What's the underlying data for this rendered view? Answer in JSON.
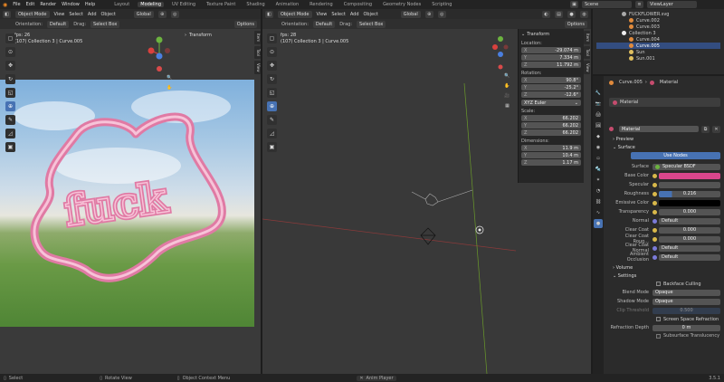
{
  "menu": {
    "items": [
      "File",
      "Edit",
      "Render",
      "Window",
      "Help"
    ]
  },
  "workspaces": [
    "Layout",
    "Modeling",
    "UV Editing",
    "Texture Paint",
    "Shading",
    "Animation",
    "Rendering",
    "Compositing",
    "Geometry Nodes",
    "Scripting"
  ],
  "active_workspace": "Modeling",
  "scene": {
    "name": "Scene",
    "view_layer": "ViewLayer"
  },
  "left_editor": {
    "mode": "Object Mode",
    "view": "View",
    "select": "Select",
    "add": "Add",
    "object": "Object",
    "transform": "Global",
    "orientation_label": "Orientation:",
    "orientation": "Default",
    "drag_label": "Drag:",
    "drag": "Select Box",
    "options": "Options",
    "fps": "fps: 26",
    "collection_info": "(107) Collection 3 | Curve.005",
    "transform_tab": "Transform",
    "overlay_text": "fuck"
  },
  "right_editor": {
    "mode": "Object Mode",
    "view": "View",
    "select": "Select",
    "add": "Add",
    "object": "Object",
    "transform": "Global",
    "orientation_label": "Orientation:",
    "orientation": "Default",
    "drag_label": "Drag:",
    "drag": "Select Box",
    "options": "Options",
    "fps": "fps: 28",
    "collection_info": "(107) Collection 3 | Curve.005"
  },
  "n_panel": {
    "title": "Transform",
    "location_label": "Location:",
    "location": [
      {
        "axis": "X",
        "value": "-29.074 m"
      },
      {
        "axis": "Y",
        "value": "7.334 m"
      },
      {
        "axis": "Z",
        "value": "11.792 m"
      }
    ],
    "rotation_label": "Rotation:",
    "rotation": [
      {
        "axis": "X",
        "value": "90.8°"
      },
      {
        "axis": "Y",
        "value": "-25.2°"
      },
      {
        "axis": "Z",
        "value": "-12.6°"
      }
    ],
    "rotation_mode": "XYZ Euler",
    "scale_label": "Scale:",
    "scale": [
      {
        "axis": "X",
        "value": "66.202"
      },
      {
        "axis": "Y",
        "value": "66.202"
      },
      {
        "axis": "Z",
        "value": "66.202"
      }
    ],
    "dimensions_label": "Dimensions:",
    "dimensions": [
      {
        "axis": "X",
        "value": "11.9 m"
      },
      {
        "axis": "Y",
        "value": "10.4 m"
      },
      {
        "axis": "Z",
        "value": "1.17 m"
      }
    ]
  },
  "side_tabs": [
    "Item",
    "Tool",
    "View"
  ],
  "outliner": {
    "items": [
      "FUCKFLOWER.svg",
      "Curve.002",
      "Curve.003",
      "Collection 3",
      "Curve.004",
      "Curve.005",
      "Sun",
      "Sun.001"
    ]
  },
  "properties": {
    "object": "Curve.005",
    "material_crumb": "Material",
    "slot": "Material",
    "material_name": "Material",
    "sections": {
      "preview": "Preview",
      "surface": "Surface",
      "volume": "Volume",
      "settings": "Settings"
    },
    "use_nodes": "Use Nodes",
    "surface_label": "Surface",
    "surface_value": "Specular BSDF",
    "rows": [
      {
        "label": "Base Color",
        "value": ""
      },
      {
        "label": "Specular",
        "value": ""
      },
      {
        "label": "Roughness",
        "value": "0.216"
      },
      {
        "label": "Emissive Color",
        "value": ""
      },
      {
        "label": "Transparency",
        "value": "0.000"
      },
      {
        "label": "Normal",
        "value": "Default"
      },
      {
        "label": "Clear Coat",
        "value": "0.000"
      },
      {
        "label": "Clear Coat Roug...",
        "value": "0.000"
      },
      {
        "label": "Clear Coat Normal",
        "value": "Default"
      },
      {
        "label": "Ambient Occlusion",
        "value": "Default"
      }
    ],
    "backface_culling": "Backface Culling",
    "blend_mode_label": "Blend Mode",
    "blend_mode": "Opaque",
    "shadow_mode_label": "Shadow Mode",
    "shadow_mode": "Opaque",
    "clip_threshold_label": "Clip Threshold",
    "clip_threshold": "0.500",
    "screen_space_refraction": "Screen Space Refraction",
    "refraction_depth_label": "Refraction Depth",
    "refraction_depth": "0 m",
    "subsurface": "Subsurface Translucency"
  },
  "status": {
    "select": "Select",
    "rotate": "Rotate View",
    "context": "Object Context Menu",
    "anim": "Anim Player",
    "version": "3.5.1"
  },
  "colors": {
    "accent": "#4772b3",
    "base_color": "#d9468c",
    "roughness_fill": "#4772b3",
    "gizmo_x": "#d9413e",
    "gizmo_y": "#6cb33f",
    "gizmo_z": "#4a7fe0"
  }
}
